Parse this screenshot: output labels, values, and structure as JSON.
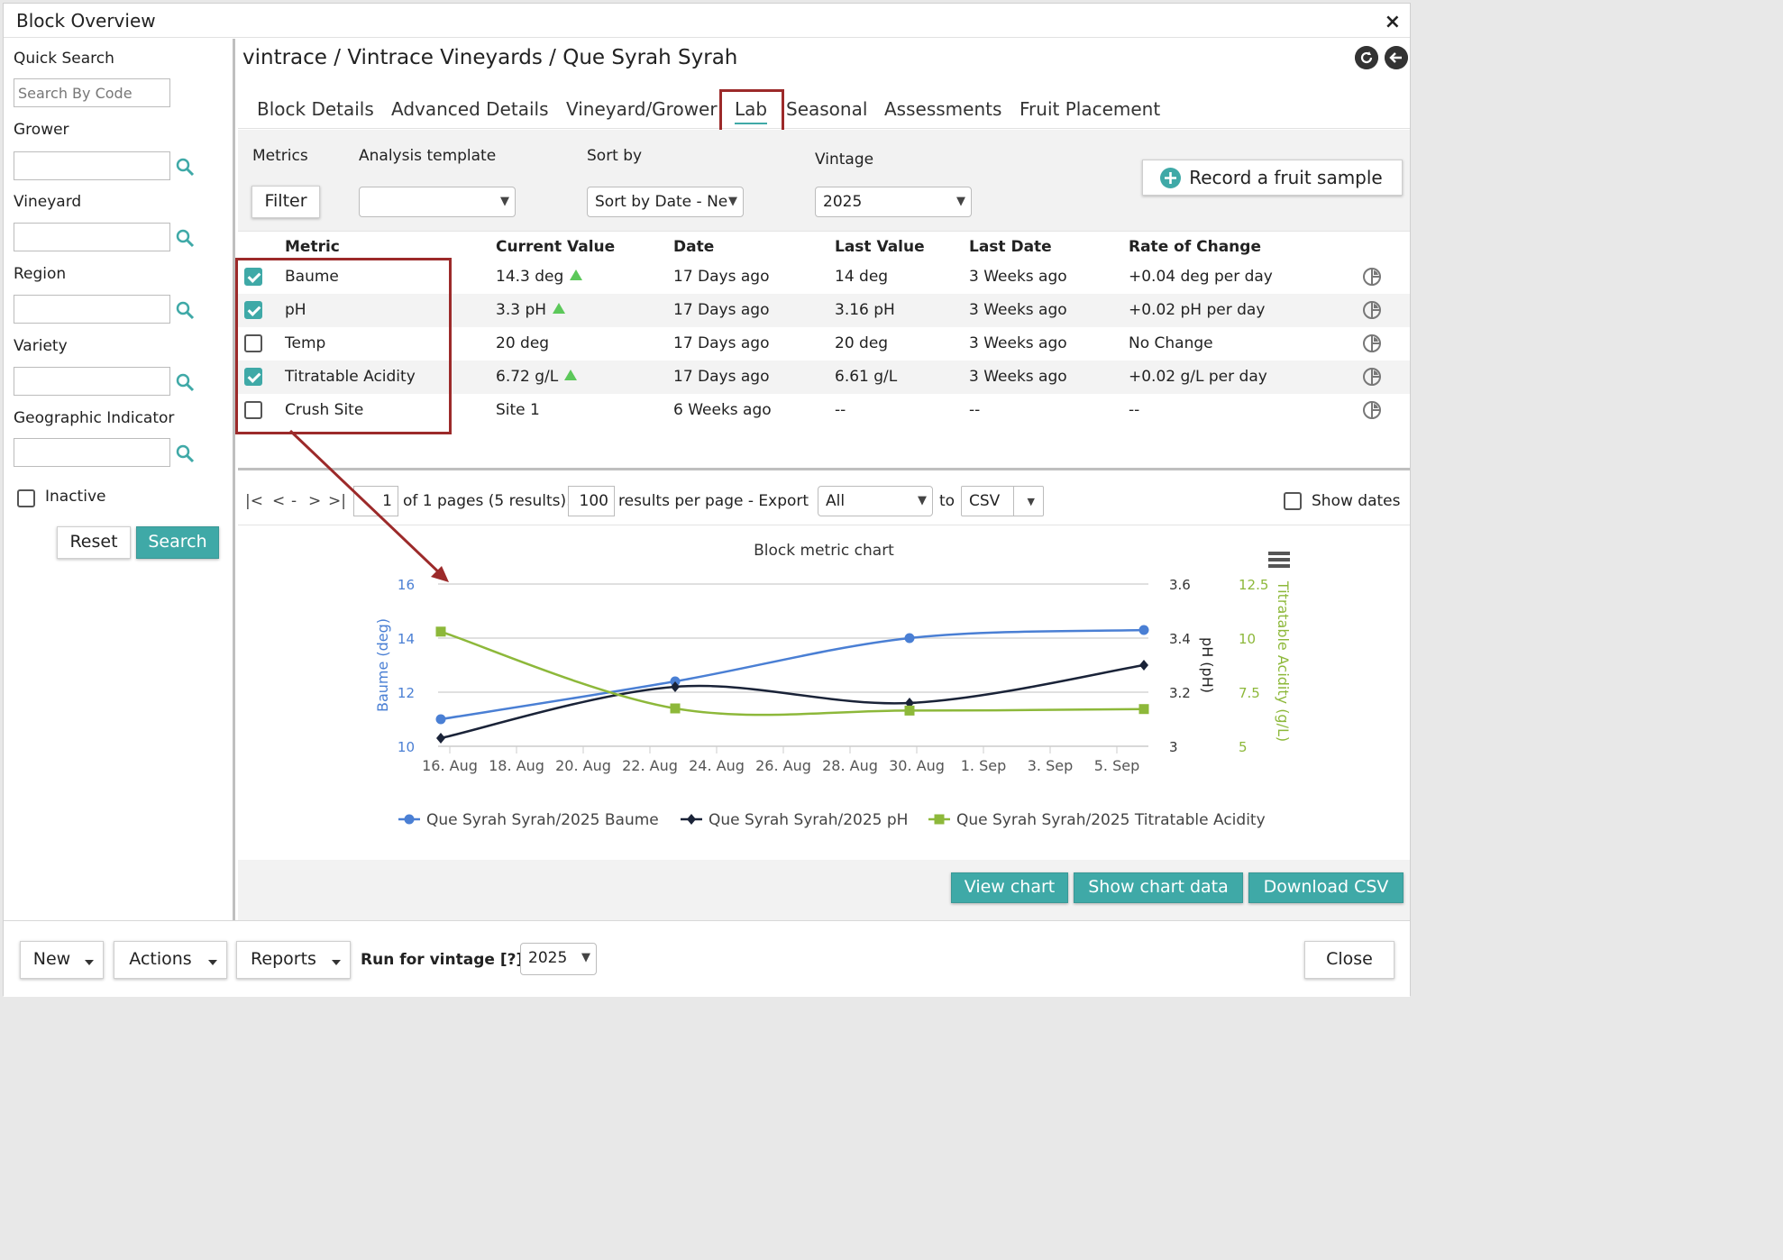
{
  "window": {
    "title": "Block Overview",
    "close_glyph": "×"
  },
  "sidebar": {
    "quick_search_label": "Quick Search",
    "quick_search_placeholder": "Search By Code",
    "grower_label": "Grower",
    "vineyard_label": "Vineyard",
    "region_label": "Region",
    "variety_label": "Variety",
    "geo_label": "Geographic Indicator",
    "inactive_label": "Inactive",
    "reset_label": "Reset",
    "search_label": "Search"
  },
  "header": {
    "breadcrumb": "vintrace / Vintrace Vineyards / Que Syrah Syrah"
  },
  "tabs": [
    "Block Details",
    "Advanced Details",
    "Vineyard/Grower",
    "Lab",
    "Seasonal",
    "Assessments",
    "Fruit Placement"
  ],
  "active_tab": "Lab",
  "filters": {
    "metrics_label": "Metrics",
    "filter_button": "Filter",
    "analysis_label": "Analysis template",
    "analysis_value": "",
    "sort_label": "Sort by",
    "sort_value": "Sort by Date - Ne",
    "vintage_label": "Vintage",
    "vintage_value": "2025",
    "record_button": "Record a fruit sample"
  },
  "table": {
    "headers": [
      "Metric",
      "Current Value",
      "Date",
      "Last Value",
      "Last Date",
      "Rate of Change"
    ],
    "rows": [
      {
        "checked": true,
        "metric": "Baume",
        "current": "14.3 deg",
        "trend_up": true,
        "date": "17 Days ago",
        "last_value": "14 deg",
        "last_date": "3 Weeks ago",
        "rate": "+0.04 deg per day"
      },
      {
        "checked": true,
        "metric": "pH",
        "current": "3.3 pH",
        "trend_up": true,
        "date": "17 Days ago",
        "last_value": "3.16 pH",
        "last_date": "3 Weeks ago",
        "rate": "+0.02 pH per day"
      },
      {
        "checked": false,
        "metric": "Temp",
        "current": "20 deg",
        "trend_up": false,
        "date": "17 Days ago",
        "last_value": "20 deg",
        "last_date": "3 Weeks ago",
        "rate": "No Change"
      },
      {
        "checked": true,
        "metric": "Titratable Acidity",
        "current": "6.72 g/L",
        "trend_up": true,
        "date": "17 Days ago",
        "last_value": "6.61 g/L",
        "last_date": "3 Weeks ago",
        "rate": "+0.02 g/L per day"
      },
      {
        "checked": false,
        "metric": "Crush Site",
        "current": "Site 1",
        "trend_up": false,
        "date": "6 Weeks ago",
        "last_value": "--",
        "last_date": "--",
        "rate": "--"
      }
    ]
  },
  "pager": {
    "first": "|<",
    "prev": "<",
    "dash": "-",
    "next": ">",
    "last": ">|",
    "page": "1",
    "of_text": "of 1 pages (5 results).",
    "per_page": "100",
    "per_page_text": "results per page - Export",
    "export_scope": "All",
    "to_text": "to",
    "export_format": "CSV",
    "show_dates_label": "Show dates"
  },
  "chart_data": {
    "type": "line",
    "title": "Block metric chart",
    "x_tick_labels": [
      "16. Aug",
      "18. Aug",
      "20. Aug",
      "22. Aug",
      "24. Aug",
      "26. Aug",
      "28. Aug",
      "30. Aug",
      "1. Sep",
      "3. Sep",
      "5. Sep"
    ],
    "axes": [
      {
        "id": "baume",
        "label": "Baume (deg)",
        "side": "left",
        "range": [
          10,
          16
        ],
        "ticks": [
          "10",
          "12",
          "14",
          "16"
        ],
        "color": "#4a7fd4"
      },
      {
        "id": "ph",
        "label": "pH (pH)",
        "side": "right",
        "range": [
          3,
          3.6
        ],
        "ticks": [
          "3",
          "3.2",
          "3.4",
          "3.6"
        ],
        "color": "#1a2338"
      },
      {
        "id": "ta",
        "label": "Titratable Acidity (g/L)",
        "side": "right",
        "range": [
          5,
          12.5
        ],
        "ticks": [
          "5",
          "7.5",
          "10",
          "12.5"
        ],
        "color": "#8db83a"
      }
    ],
    "series": [
      {
        "name": "Que Syrah Syrah/2025 Baume",
        "axis": "baume",
        "color": "#4a7fd4",
        "marker": "circle",
        "points": [
          [
            "2025-08-16",
            11.0
          ],
          [
            "2025-08-23",
            12.4
          ],
          [
            "2025-08-30",
            14.0
          ],
          [
            "2025-09-06",
            14.3
          ]
        ]
      },
      {
        "name": "Que Syrah Syrah/2025 pH",
        "axis": "ph",
        "color": "#1a2338",
        "marker": "diamond",
        "points": [
          [
            "2025-08-16",
            3.03
          ],
          [
            "2025-08-23",
            3.22
          ],
          [
            "2025-08-30",
            3.16
          ],
          [
            "2025-09-06",
            3.3
          ]
        ]
      },
      {
        "name": "Que Syrah Syrah/2025 Titratable Acidity",
        "axis": "ta",
        "color": "#8db83a",
        "marker": "square",
        "points": [
          [
            "2025-08-16",
            10.3
          ],
          [
            "2025-08-23",
            6.75
          ],
          [
            "2025-08-30",
            6.65
          ],
          [
            "2025-09-06",
            6.72
          ]
        ]
      }
    ],
    "grid": true,
    "legend": "bottom"
  },
  "chart_buttons": {
    "view": "View chart",
    "data": "Show chart data",
    "download": "Download CSV"
  },
  "footer": {
    "new": "New",
    "actions": "Actions",
    "reports": "Reports",
    "run_label": "Run for vintage [?]",
    "run_vintage": "2025",
    "close": "Close"
  },
  "colors": {
    "accent": "#3fa9a7",
    "highlight": "#9c2a2a",
    "trend_up": "#5cc85a"
  }
}
